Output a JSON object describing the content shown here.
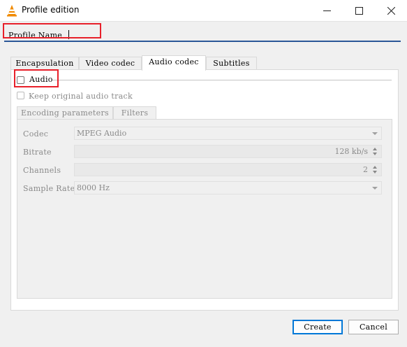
{
  "window": {
    "title": "Profile edition",
    "min_icon": "minimize-icon",
    "max_icon": "maximize-icon",
    "close_icon": "close-icon"
  },
  "profile": {
    "label": "Profile Name",
    "value": ""
  },
  "tabs": [
    {
      "label": "Encapsulation"
    },
    {
      "label": "Video codec"
    },
    {
      "label": "Audio codec",
      "active": true
    },
    {
      "label": "Subtitles"
    }
  ],
  "audio": {
    "enable_label": "Audio",
    "enabled": false,
    "keep_label": "Keep original audio track",
    "keep_checked": false
  },
  "subtabs": [
    {
      "label": "Encoding parameters"
    },
    {
      "label": "Filters"
    }
  ],
  "fields": {
    "codec_label": "Codec",
    "codec_value": "MPEG Audio",
    "bitrate_label": "Bitrate",
    "bitrate_value": "128 kb/s",
    "channels_label": "Channels",
    "channels_value": "2",
    "samplerate_label": "Sample Rate",
    "samplerate_value": "8000 Hz"
  },
  "buttons": {
    "create": "Create",
    "cancel": "Cancel"
  },
  "colors": {
    "accent": "#0078d7",
    "highlight": "#e8202a",
    "underline": "#2b5797"
  }
}
